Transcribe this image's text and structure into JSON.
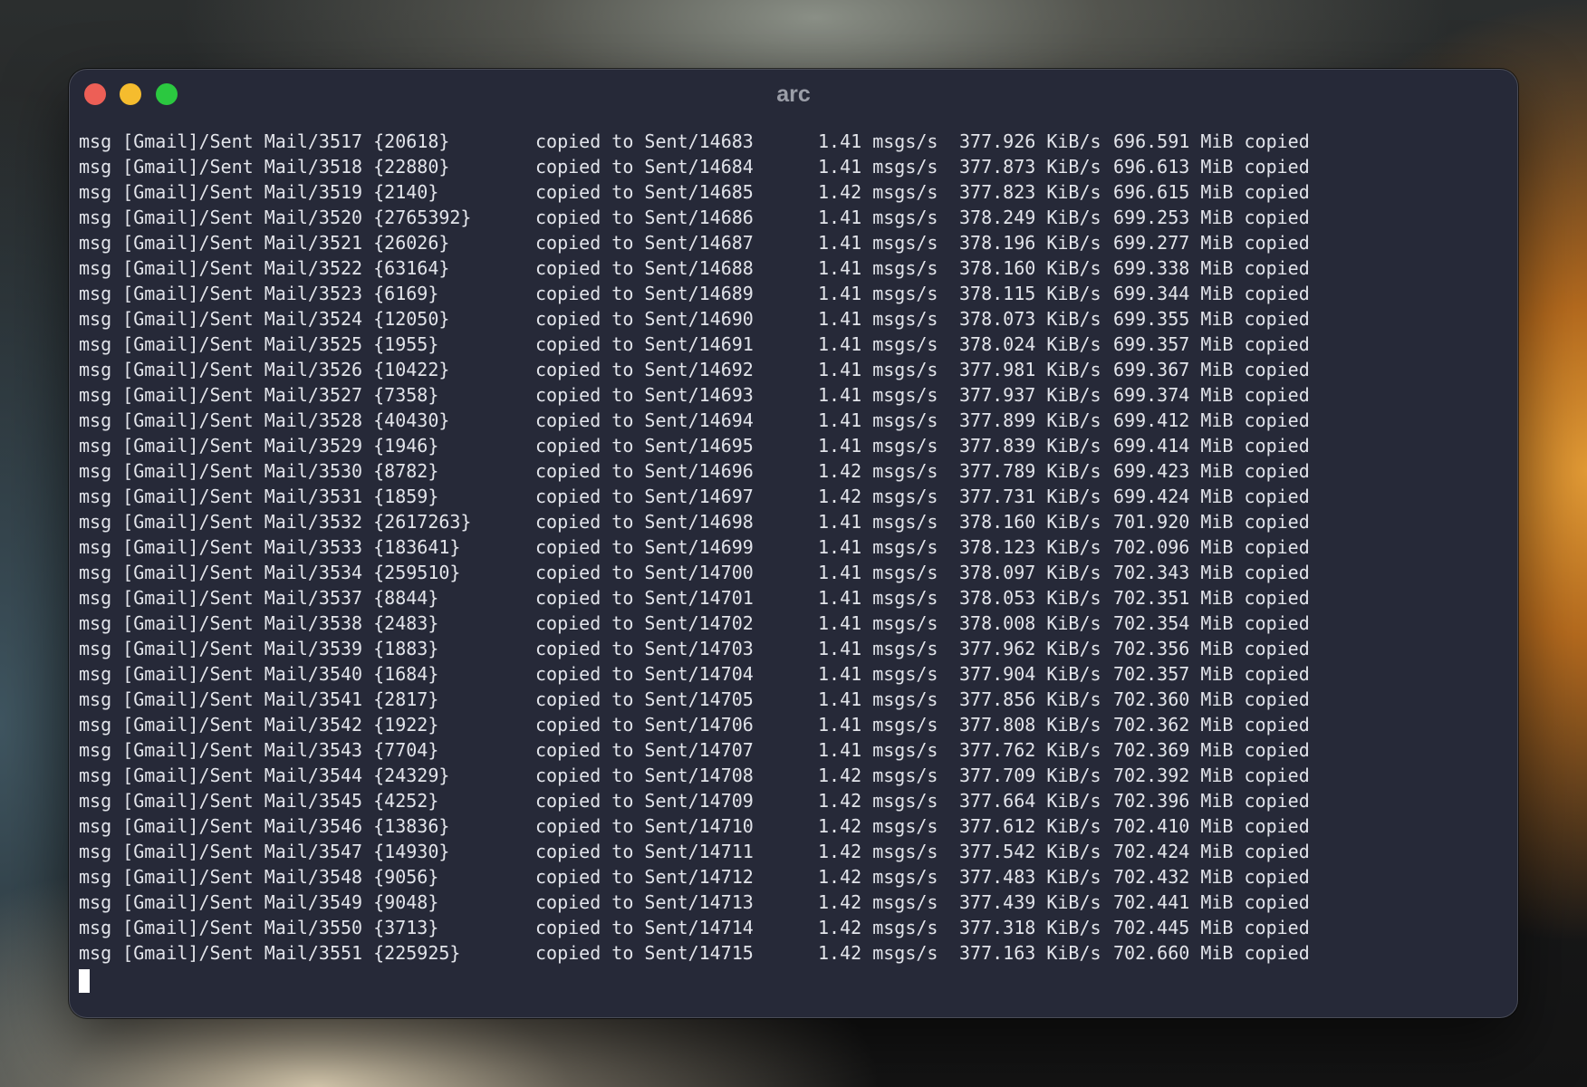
{
  "window": {
    "title": "arc"
  },
  "terminal": {
    "lines": [
      {
        "src": "msg [Gmail]/Sent Mail/3517 {20618}",
        "dst": "copied to Sent/14683",
        "rate": "1.41 msgs/s",
        "kib": "377.926 KiB/s",
        "mib": "696.591 MiB copied"
      },
      {
        "src": "msg [Gmail]/Sent Mail/3518 {22880}",
        "dst": "copied to Sent/14684",
        "rate": "1.41 msgs/s",
        "kib": "377.873 KiB/s",
        "mib": "696.613 MiB copied"
      },
      {
        "src": "msg [Gmail]/Sent Mail/3519 {2140}",
        "dst": "copied to Sent/14685",
        "rate": "1.42 msgs/s",
        "kib": "377.823 KiB/s",
        "mib": "696.615 MiB copied"
      },
      {
        "src": "msg [Gmail]/Sent Mail/3520 {2765392}",
        "dst": "copied to Sent/14686",
        "rate": "1.41 msgs/s",
        "kib": "378.249 KiB/s",
        "mib": "699.253 MiB copied"
      },
      {
        "src": "msg [Gmail]/Sent Mail/3521 {26026}",
        "dst": "copied to Sent/14687",
        "rate": "1.41 msgs/s",
        "kib": "378.196 KiB/s",
        "mib": "699.277 MiB copied"
      },
      {
        "src": "msg [Gmail]/Sent Mail/3522 {63164}",
        "dst": "copied to Sent/14688",
        "rate": "1.41 msgs/s",
        "kib": "378.160 KiB/s",
        "mib": "699.338 MiB copied"
      },
      {
        "src": "msg [Gmail]/Sent Mail/3523 {6169}",
        "dst": "copied to Sent/14689",
        "rate": "1.41 msgs/s",
        "kib": "378.115 KiB/s",
        "mib": "699.344 MiB copied"
      },
      {
        "src": "msg [Gmail]/Sent Mail/3524 {12050}",
        "dst": "copied to Sent/14690",
        "rate": "1.41 msgs/s",
        "kib": "378.073 KiB/s",
        "mib": "699.355 MiB copied"
      },
      {
        "src": "msg [Gmail]/Sent Mail/3525 {1955}",
        "dst": "copied to Sent/14691",
        "rate": "1.41 msgs/s",
        "kib": "378.024 KiB/s",
        "mib": "699.357 MiB copied"
      },
      {
        "src": "msg [Gmail]/Sent Mail/3526 {10422}",
        "dst": "copied to Sent/14692",
        "rate": "1.41 msgs/s",
        "kib": "377.981 KiB/s",
        "mib": "699.367 MiB copied"
      },
      {
        "src": "msg [Gmail]/Sent Mail/3527 {7358}",
        "dst": "copied to Sent/14693",
        "rate": "1.41 msgs/s",
        "kib": "377.937 KiB/s",
        "mib": "699.374 MiB copied"
      },
      {
        "src": "msg [Gmail]/Sent Mail/3528 {40430}",
        "dst": "copied to Sent/14694",
        "rate": "1.41 msgs/s",
        "kib": "377.899 KiB/s",
        "mib": "699.412 MiB copied"
      },
      {
        "src": "msg [Gmail]/Sent Mail/3529 {1946}",
        "dst": "copied to Sent/14695",
        "rate": "1.41 msgs/s",
        "kib": "377.839 KiB/s",
        "mib": "699.414 MiB copied"
      },
      {
        "src": "msg [Gmail]/Sent Mail/3530 {8782}",
        "dst": "copied to Sent/14696",
        "rate": "1.42 msgs/s",
        "kib": "377.789 KiB/s",
        "mib": "699.423 MiB copied"
      },
      {
        "src": "msg [Gmail]/Sent Mail/3531 {1859}",
        "dst": "copied to Sent/14697",
        "rate": "1.42 msgs/s",
        "kib": "377.731 KiB/s",
        "mib": "699.424 MiB copied"
      },
      {
        "src": "msg [Gmail]/Sent Mail/3532 {2617263}",
        "dst": "copied to Sent/14698",
        "rate": "1.41 msgs/s",
        "kib": "378.160 KiB/s",
        "mib": "701.920 MiB copied"
      },
      {
        "src": "msg [Gmail]/Sent Mail/3533 {183641}",
        "dst": "copied to Sent/14699",
        "rate": "1.41 msgs/s",
        "kib": "378.123 KiB/s",
        "mib": "702.096 MiB copied"
      },
      {
        "src": "msg [Gmail]/Sent Mail/3534 {259510}",
        "dst": "copied to Sent/14700",
        "rate": "1.41 msgs/s",
        "kib": "378.097 KiB/s",
        "mib": "702.343 MiB copied"
      },
      {
        "src": "msg [Gmail]/Sent Mail/3537 {8844}",
        "dst": "copied to Sent/14701",
        "rate": "1.41 msgs/s",
        "kib": "378.053 KiB/s",
        "mib": "702.351 MiB copied"
      },
      {
        "src": "msg [Gmail]/Sent Mail/3538 {2483}",
        "dst": "copied to Sent/14702",
        "rate": "1.41 msgs/s",
        "kib": "378.008 KiB/s",
        "mib": "702.354 MiB copied"
      },
      {
        "src": "msg [Gmail]/Sent Mail/3539 {1883}",
        "dst": "copied to Sent/14703",
        "rate": "1.41 msgs/s",
        "kib": "377.962 KiB/s",
        "mib": "702.356 MiB copied"
      },
      {
        "src": "msg [Gmail]/Sent Mail/3540 {1684}",
        "dst": "copied to Sent/14704",
        "rate": "1.41 msgs/s",
        "kib": "377.904 KiB/s",
        "mib": "702.357 MiB copied"
      },
      {
        "src": "msg [Gmail]/Sent Mail/3541 {2817}",
        "dst": "copied to Sent/14705",
        "rate": "1.41 msgs/s",
        "kib": "377.856 KiB/s",
        "mib": "702.360 MiB copied"
      },
      {
        "src": "msg [Gmail]/Sent Mail/3542 {1922}",
        "dst": "copied to Sent/14706",
        "rate": "1.41 msgs/s",
        "kib": "377.808 KiB/s",
        "mib": "702.362 MiB copied"
      },
      {
        "src": "msg [Gmail]/Sent Mail/3543 {7704}",
        "dst": "copied to Sent/14707",
        "rate": "1.41 msgs/s",
        "kib": "377.762 KiB/s",
        "mib": "702.369 MiB copied"
      },
      {
        "src": "msg [Gmail]/Sent Mail/3544 {24329}",
        "dst": "copied to Sent/14708",
        "rate": "1.42 msgs/s",
        "kib": "377.709 KiB/s",
        "mib": "702.392 MiB copied"
      },
      {
        "src": "msg [Gmail]/Sent Mail/3545 {4252}",
        "dst": "copied to Sent/14709",
        "rate": "1.42 msgs/s",
        "kib": "377.664 KiB/s",
        "mib": "702.396 MiB copied"
      },
      {
        "src": "msg [Gmail]/Sent Mail/3546 {13836}",
        "dst": "copied to Sent/14710",
        "rate": "1.42 msgs/s",
        "kib": "377.612 KiB/s",
        "mib": "702.410 MiB copied"
      },
      {
        "src": "msg [Gmail]/Sent Mail/3547 {14930}",
        "dst": "copied to Sent/14711",
        "rate": "1.42 msgs/s",
        "kib": "377.542 KiB/s",
        "mib": "702.424 MiB copied"
      },
      {
        "src": "msg [Gmail]/Sent Mail/3548 {9056}",
        "dst": "copied to Sent/14712",
        "rate": "1.42 msgs/s",
        "kib": "377.483 KiB/s",
        "mib": "702.432 MiB copied"
      },
      {
        "src": "msg [Gmail]/Sent Mail/3549 {9048}",
        "dst": "copied to Sent/14713",
        "rate": "1.42 msgs/s",
        "kib": "377.439 KiB/s",
        "mib": "702.441 MiB copied"
      },
      {
        "src": "msg [Gmail]/Sent Mail/3550 {3713}",
        "dst": "copied to Sent/14714",
        "rate": "1.42 msgs/s",
        "kib": "377.318 KiB/s",
        "mib": "702.445 MiB copied"
      },
      {
        "src": "msg [Gmail]/Sent Mail/3551 {225925}",
        "dst": "copied to Sent/14715",
        "rate": "1.42 msgs/s",
        "kib": "377.163 KiB/s",
        "mib": "702.660 MiB copied"
      }
    ]
  },
  "icons": {
    "close": "close-button-icon",
    "minimize": "minimize-button-icon",
    "maximize": "maximize-button-icon"
  },
  "colors": {
    "window_bg": "#262938",
    "text": "#e2e4ea",
    "title": "#9b9ea8",
    "close": "#ed5f56",
    "minimize": "#f5bc2e",
    "maximize": "#2bc840",
    "cursor": "#ffffff"
  }
}
